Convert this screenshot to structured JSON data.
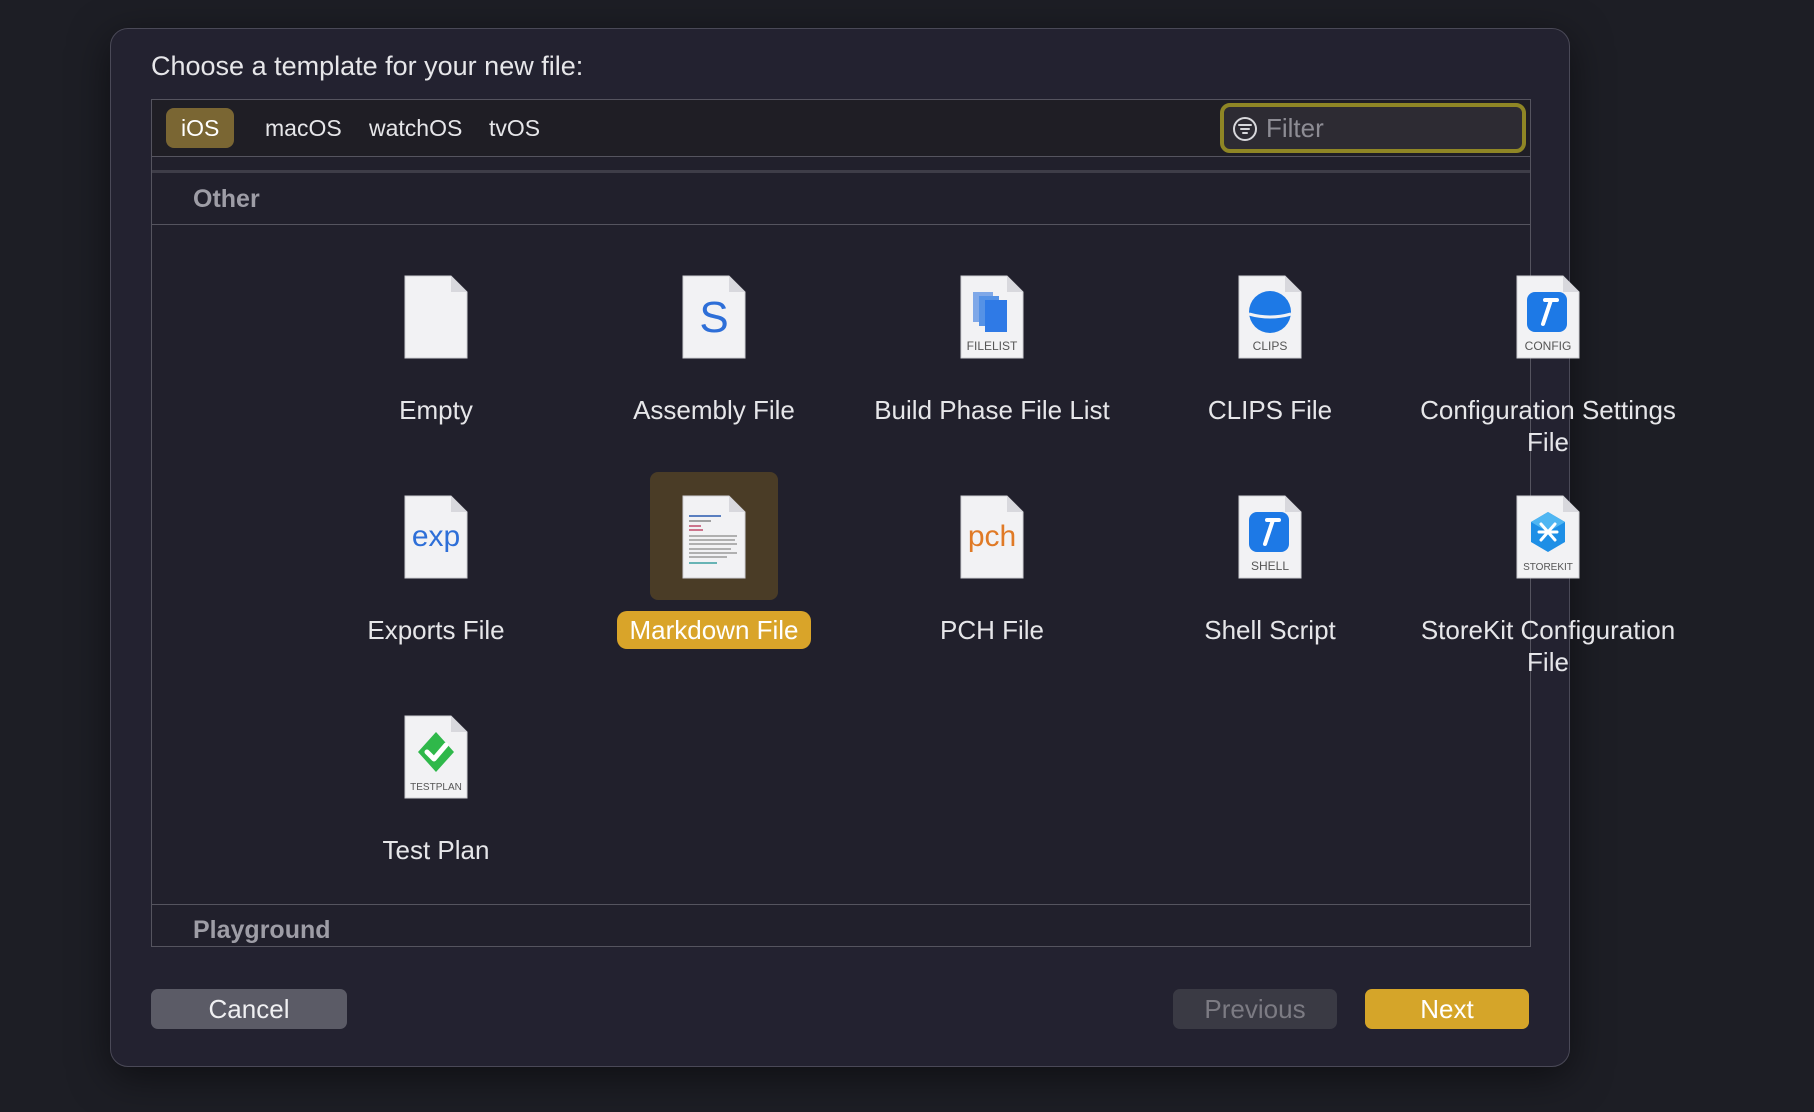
{
  "dialog": {
    "title": "Choose a template for your new file:"
  },
  "tabs": [
    {
      "label": "iOS",
      "selected": true
    },
    {
      "label": "macOS",
      "selected": false
    },
    {
      "label": "watchOS",
      "selected": false
    },
    {
      "label": "tvOS",
      "selected": false
    }
  ],
  "filter": {
    "placeholder": "Filter",
    "value": ""
  },
  "sections": {
    "other": "Other",
    "playground": "Playground"
  },
  "templates": [
    {
      "label": "Empty",
      "icon": "empty-file-icon"
    },
    {
      "label": "Assembly File",
      "icon": "assembly-file-icon",
      "glyph": "S"
    },
    {
      "label": "Build Phase File List",
      "icon": "filelist-icon",
      "badge": "FILELIST"
    },
    {
      "label": "CLIPS File",
      "icon": "clips-icon",
      "badge": "CLIPS"
    },
    {
      "label": "Configuration Settings File",
      "icon": "config-icon",
      "badge": "CONFIG"
    },
    {
      "label": "Exports File",
      "icon": "exports-file-icon",
      "glyph": "exp"
    },
    {
      "label": "Markdown File",
      "icon": "markdown-file-icon",
      "selected": true
    },
    {
      "label": "PCH File",
      "icon": "pch-file-icon",
      "glyph": "pch"
    },
    {
      "label": "Shell Script",
      "icon": "shell-script-icon",
      "badge": "SHELL"
    },
    {
      "label": "StoreKit Configuration File",
      "icon": "storekit-icon",
      "badge": "STOREKIT"
    },
    {
      "label": "Test Plan",
      "icon": "testplan-icon",
      "badge": "TESTPLAN"
    }
  ],
  "buttons": {
    "cancel": "Cancel",
    "previous": "Previous",
    "next": "Next"
  },
  "colors": {
    "accent": "#d5a529",
    "selected_tab": "#7a6633",
    "filter_focus_ring": "#8f8625",
    "background": "#232230"
  }
}
